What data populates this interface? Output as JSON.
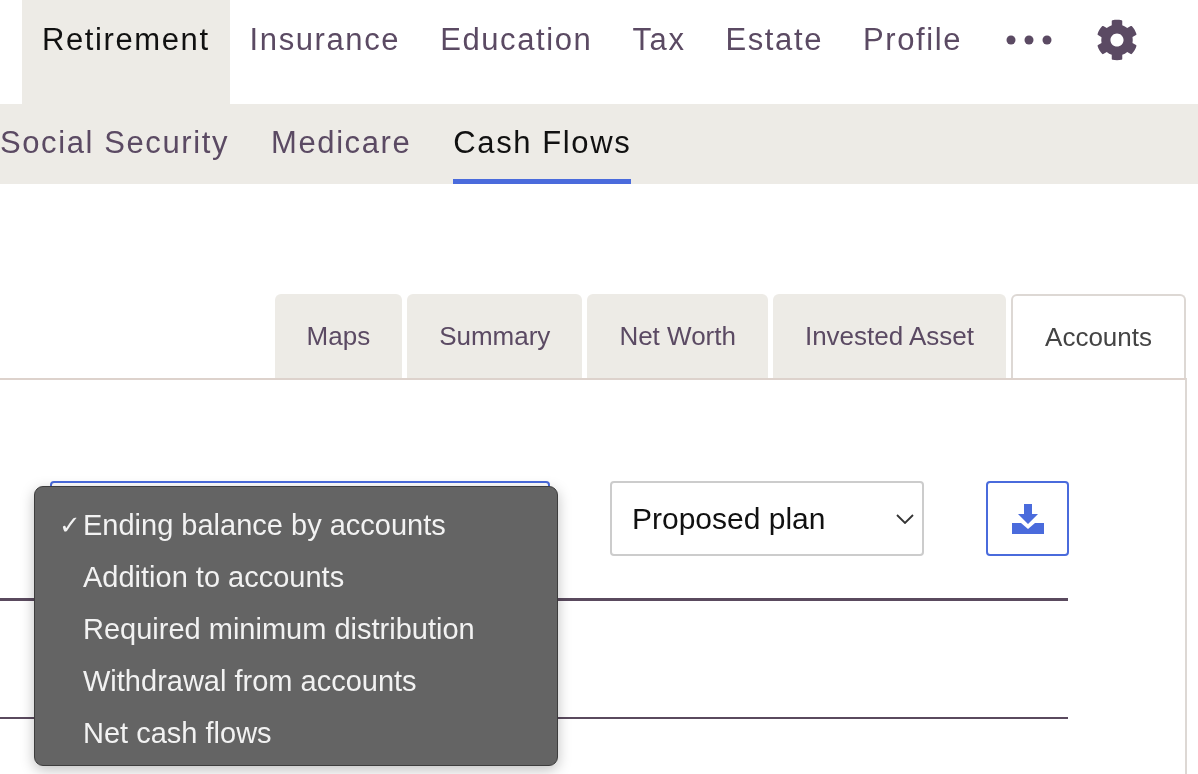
{
  "main_nav": [
    {
      "label": "Retirement",
      "selected": true
    },
    {
      "label": "Insurance",
      "selected": false
    },
    {
      "label": "Education",
      "selected": false
    },
    {
      "label": "Tax",
      "selected": false
    },
    {
      "label": "Estate",
      "selected": false
    },
    {
      "label": "Profile",
      "selected": false
    }
  ],
  "sub_nav": [
    {
      "label": "Social Security",
      "selected": false
    },
    {
      "label": "Medicare",
      "selected": false
    },
    {
      "label": "Cash Flows",
      "selected": true
    }
  ],
  "tabs": [
    {
      "label": "Maps",
      "selected": false
    },
    {
      "label": "Summary",
      "selected": false
    },
    {
      "label": "Net Worth",
      "selected": false
    },
    {
      "label": "Invested Asset",
      "selected": false
    },
    {
      "label": "Accounts",
      "selected": true
    }
  ],
  "view_menu": {
    "check_mark": "✓",
    "items": [
      {
        "label": "Ending balance by accounts",
        "checked": true
      },
      {
        "label": "Addition to accounts",
        "checked": false
      },
      {
        "label": "Required minimum distribution",
        "checked": false
      },
      {
        "label": "Withdrawal from accounts",
        "checked": false
      },
      {
        "label": "Net cash flows",
        "checked": false
      }
    ]
  },
  "plan_select": {
    "value": "Proposed plan"
  }
}
